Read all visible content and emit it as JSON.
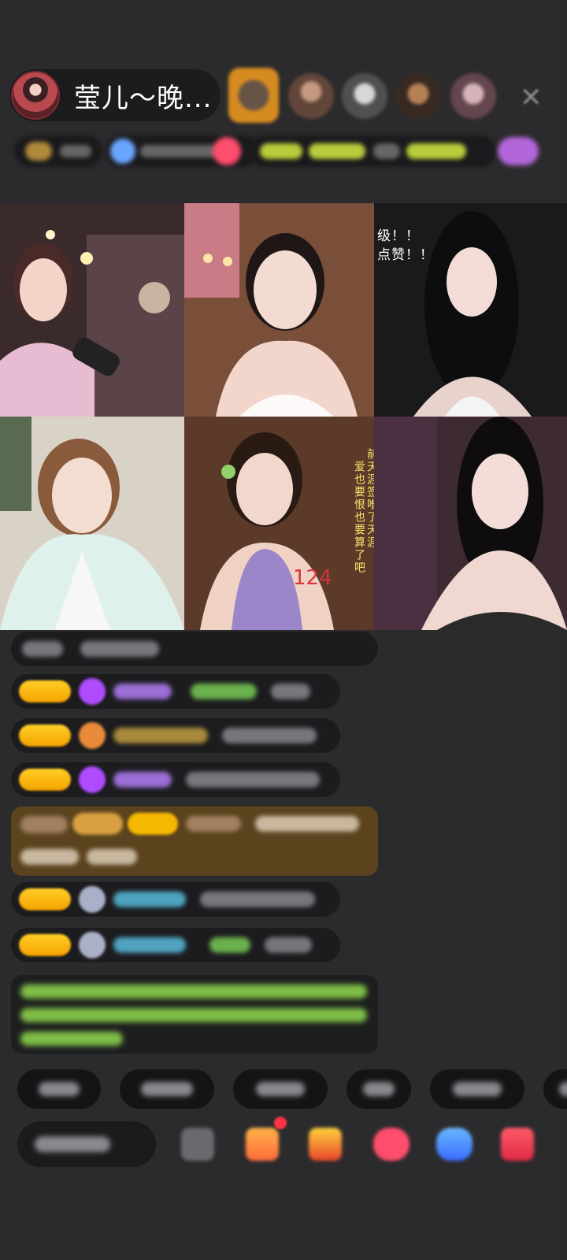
{
  "header": {
    "host_name": "莹儿～晚...",
    "close_icon": "close-icon"
  },
  "video_grid": {
    "tile_overlay_number": "124",
    "ticker_text": "级！！\n点赞！！",
    "vertical_text_1": "爱也要恨也要算了吧",
    "vertical_text_2": "前天涯签唯了天涯"
  },
  "colors": {
    "background": "#2b2b2d",
    "pill": "#1c1c1e",
    "level_badge": "#f5b800",
    "gold_message": "#5b431e",
    "green_text": "#8fd94d"
  }
}
